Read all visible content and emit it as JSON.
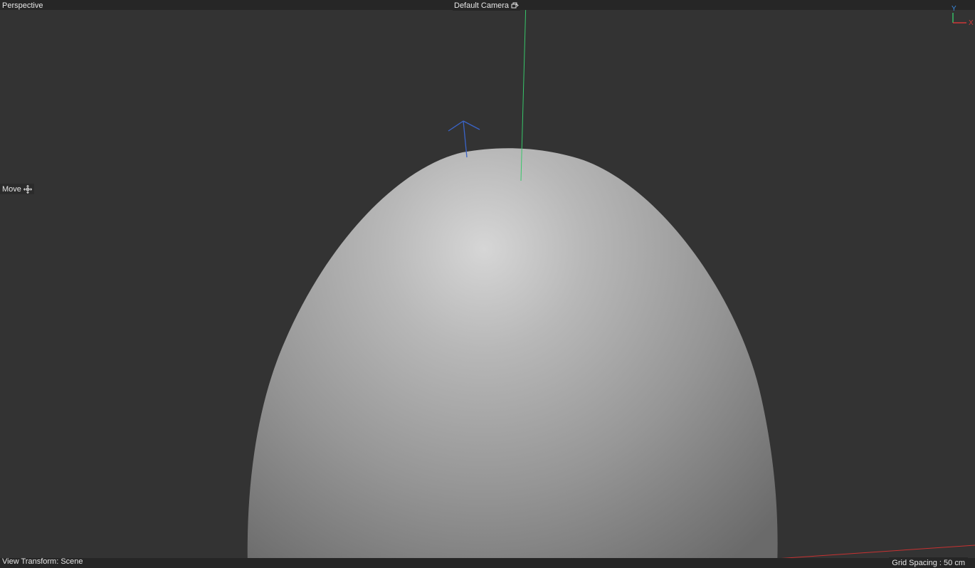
{
  "viewport": {
    "view_name": "Perspective",
    "camera_label": "Default Camera",
    "tool_label": "Move",
    "view_transform": "View Transform: Scene",
    "grid_spacing": "Grid Spacing : 50 cm"
  },
  "gizmo": {
    "y_label": "Y",
    "x_label": "X"
  },
  "icons": {
    "camera": "camera-switch-icon",
    "move": "move-arrows-icon"
  },
  "colors": {
    "background": "#333333",
    "bar": "#262626",
    "text": "#e6e6e6",
    "axis_x": "#d03838",
    "axis_y": "#37c76a",
    "axis_z": "#3a64c8"
  }
}
